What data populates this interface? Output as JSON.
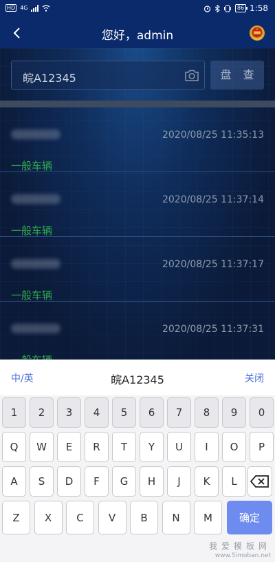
{
  "status_bar": {
    "hd": "HD",
    "network": "4G",
    "battery": "86",
    "time": "1:58"
  },
  "nav": {
    "title": "您好，admin"
  },
  "search": {
    "plate_value": "皖A12345",
    "check_label": "盘 查"
  },
  "records": [
    {
      "time": "2020/08/25 11:35:13",
      "type": "一般车辆"
    },
    {
      "time": "2020/08/25 11:37:14",
      "type": "一般车辆"
    },
    {
      "time": "2020/08/25 11:37:17",
      "type": "一般车辆"
    },
    {
      "time": "2020/08/25 11:37:31",
      "type": "一般车辆"
    }
  ],
  "keyboard": {
    "lang_label": "中/英",
    "preview": "皖A12345",
    "close_label": "关闭",
    "row1": [
      "1",
      "2",
      "3",
      "4",
      "5",
      "6",
      "7",
      "8",
      "9",
      "0"
    ],
    "row2": [
      "Q",
      "W",
      "E",
      "R",
      "T",
      "Y",
      "U",
      "I",
      "O",
      "P"
    ],
    "row3": [
      "A",
      "S",
      "D",
      "F",
      "G",
      "H",
      "J",
      "K",
      "L"
    ],
    "row4": [
      "Z",
      "X",
      "C",
      "V",
      "B",
      "N",
      "M"
    ],
    "confirm_label": "确定"
  },
  "watermark": {
    "text": "我爱模板网",
    "url": "www.5imoban.net"
  },
  "colors": {
    "nav_bg": "#0a2a6c",
    "accent": "#6e8cf0",
    "vehicle_type": "#2eab4a",
    "link": "#4a6fd8"
  }
}
